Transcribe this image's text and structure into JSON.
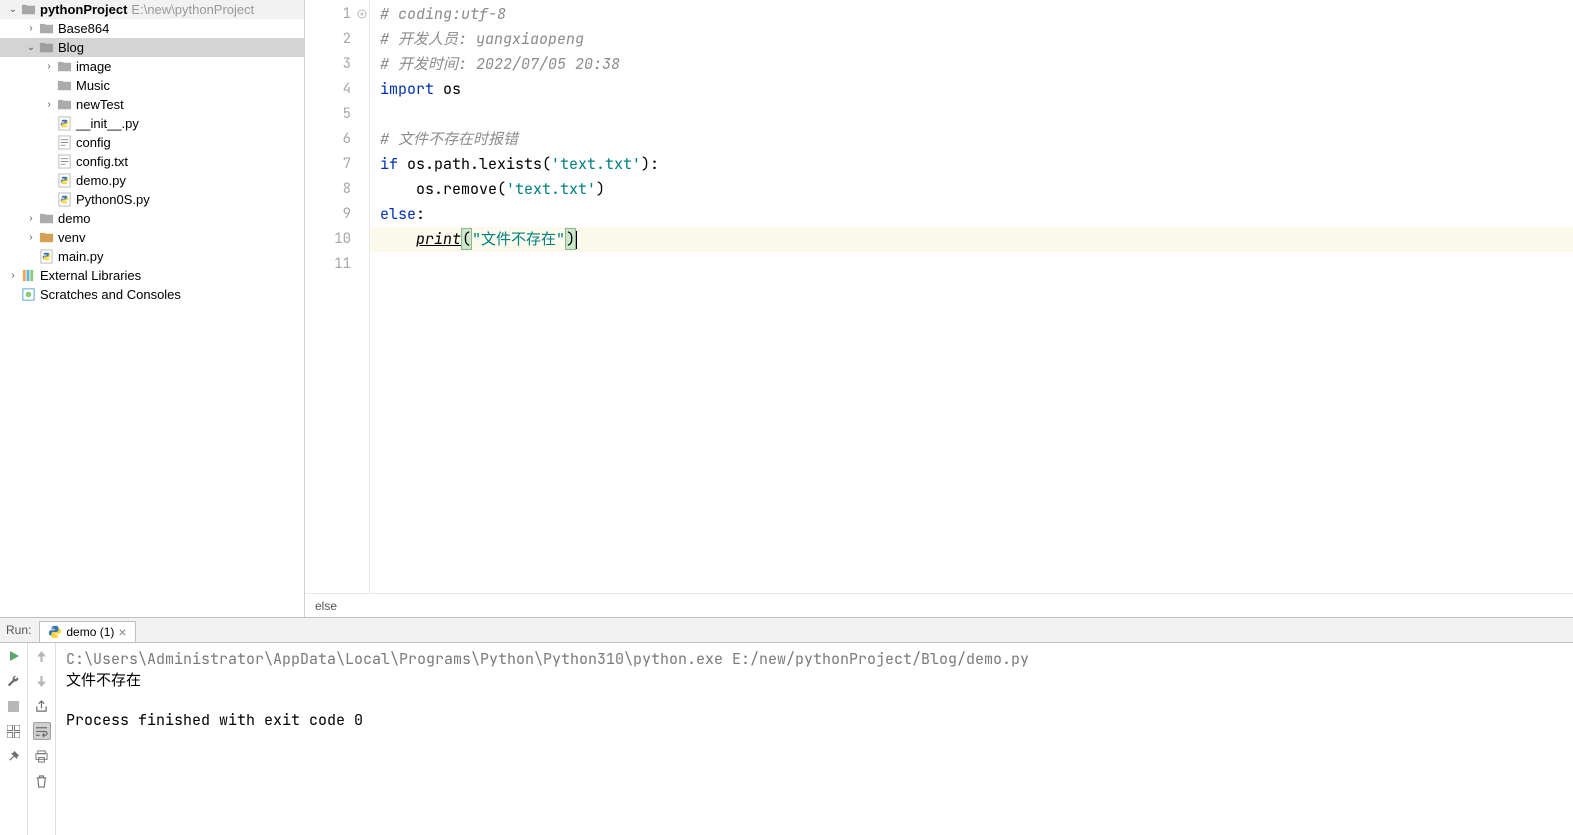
{
  "project": {
    "name": "pythonProject",
    "path": "E:\\new\\pythonProject"
  },
  "tree": [
    {
      "indent": 0,
      "arrow": "down",
      "iconType": "folder",
      "label": "pythonProject",
      "bold": true,
      "pathSuffix": "E:\\new\\pythonProject",
      "selected": false
    },
    {
      "indent": 1,
      "arrow": "right",
      "iconType": "folder",
      "label": "Base864",
      "selected": false
    },
    {
      "indent": 1,
      "arrow": "down",
      "iconType": "folder",
      "label": "Blog",
      "selected": true
    },
    {
      "indent": 2,
      "arrow": "right",
      "iconType": "folder",
      "label": "image",
      "selected": false
    },
    {
      "indent": 2,
      "arrow": "",
      "iconType": "folder",
      "label": "Music",
      "selected": false
    },
    {
      "indent": 2,
      "arrow": "right",
      "iconType": "folder",
      "label": "newTest",
      "selected": false
    },
    {
      "indent": 2,
      "arrow": "",
      "iconType": "pyfile",
      "label": "__init__.py",
      "selected": false
    },
    {
      "indent": 2,
      "arrow": "",
      "iconType": "txtfile",
      "label": "config",
      "selected": false
    },
    {
      "indent": 2,
      "arrow": "",
      "iconType": "txtfile",
      "label": "config.txt",
      "selected": false
    },
    {
      "indent": 2,
      "arrow": "",
      "iconType": "pyfile",
      "label": "demo.py",
      "selected": false
    },
    {
      "indent": 2,
      "arrow": "",
      "iconType": "pyfile",
      "label": "Python0S.py",
      "selected": false
    },
    {
      "indent": 1,
      "arrow": "right",
      "iconType": "folder",
      "label": "demo",
      "selected": false
    },
    {
      "indent": 1,
      "arrow": "right",
      "iconType": "folder-venv",
      "label": "venv",
      "selected": false
    },
    {
      "indent": 1,
      "arrow": "",
      "iconType": "pyfile",
      "label": "main.py",
      "selected": false
    },
    {
      "indent": 0,
      "arrow": "right",
      "iconType": "lib",
      "label": "External Libraries",
      "selected": false
    },
    {
      "indent": 0,
      "arrow": "",
      "iconType": "scratch",
      "label": "Scratches and Consoles",
      "selected": false
    }
  ],
  "code": {
    "lines": [
      {
        "n": 1,
        "type": "comment",
        "html": "# coding:utf-8"
      },
      {
        "n": 2,
        "type": "comment",
        "html": "# 开发人员: yangxiaopeng"
      },
      {
        "n": 3,
        "type": "comment",
        "html": "# 开发时间: 2022/07/05 20:38"
      },
      {
        "n": 4,
        "type": "import",
        "kw": "import",
        "mod": "os"
      },
      {
        "n": 5,
        "type": "blank"
      },
      {
        "n": 6,
        "type": "comment",
        "html": "# 文件不存在时报错"
      },
      {
        "n": 7,
        "type": "if",
        "kw": "if",
        "rest1": " os.path.lexists(",
        "str": "'text.txt'",
        "rest2": "):"
      },
      {
        "n": 8,
        "type": "call",
        "indent": "    ",
        "rest1": "os.remove(",
        "str": "'text.txt'",
        "rest2": ")"
      },
      {
        "n": 9,
        "type": "else",
        "kw": "else",
        "rest": ":"
      },
      {
        "n": 10,
        "type": "print",
        "indent": "    ",
        "func": "print",
        "open": "(",
        "str": "\"文件不存在\"",
        "close": ")",
        "current": true
      },
      {
        "n": 11,
        "type": "blank"
      }
    ],
    "breadcrumb": "else"
  },
  "run": {
    "panelLabel": "Run:",
    "tabLabel": "demo (1)",
    "consoleLines": [
      {
        "cls": "cmd",
        "text": "C:\\Users\\Administrator\\AppData\\Local\\Programs\\Python\\Python310\\python.exe E:/new/pythonProject/Blog/demo.py"
      },
      {
        "cls": "out",
        "text": "文件不存在"
      },
      {
        "cls": "out",
        "text": ""
      },
      {
        "cls": "out",
        "text": "Process finished with exit code 0"
      }
    ]
  }
}
